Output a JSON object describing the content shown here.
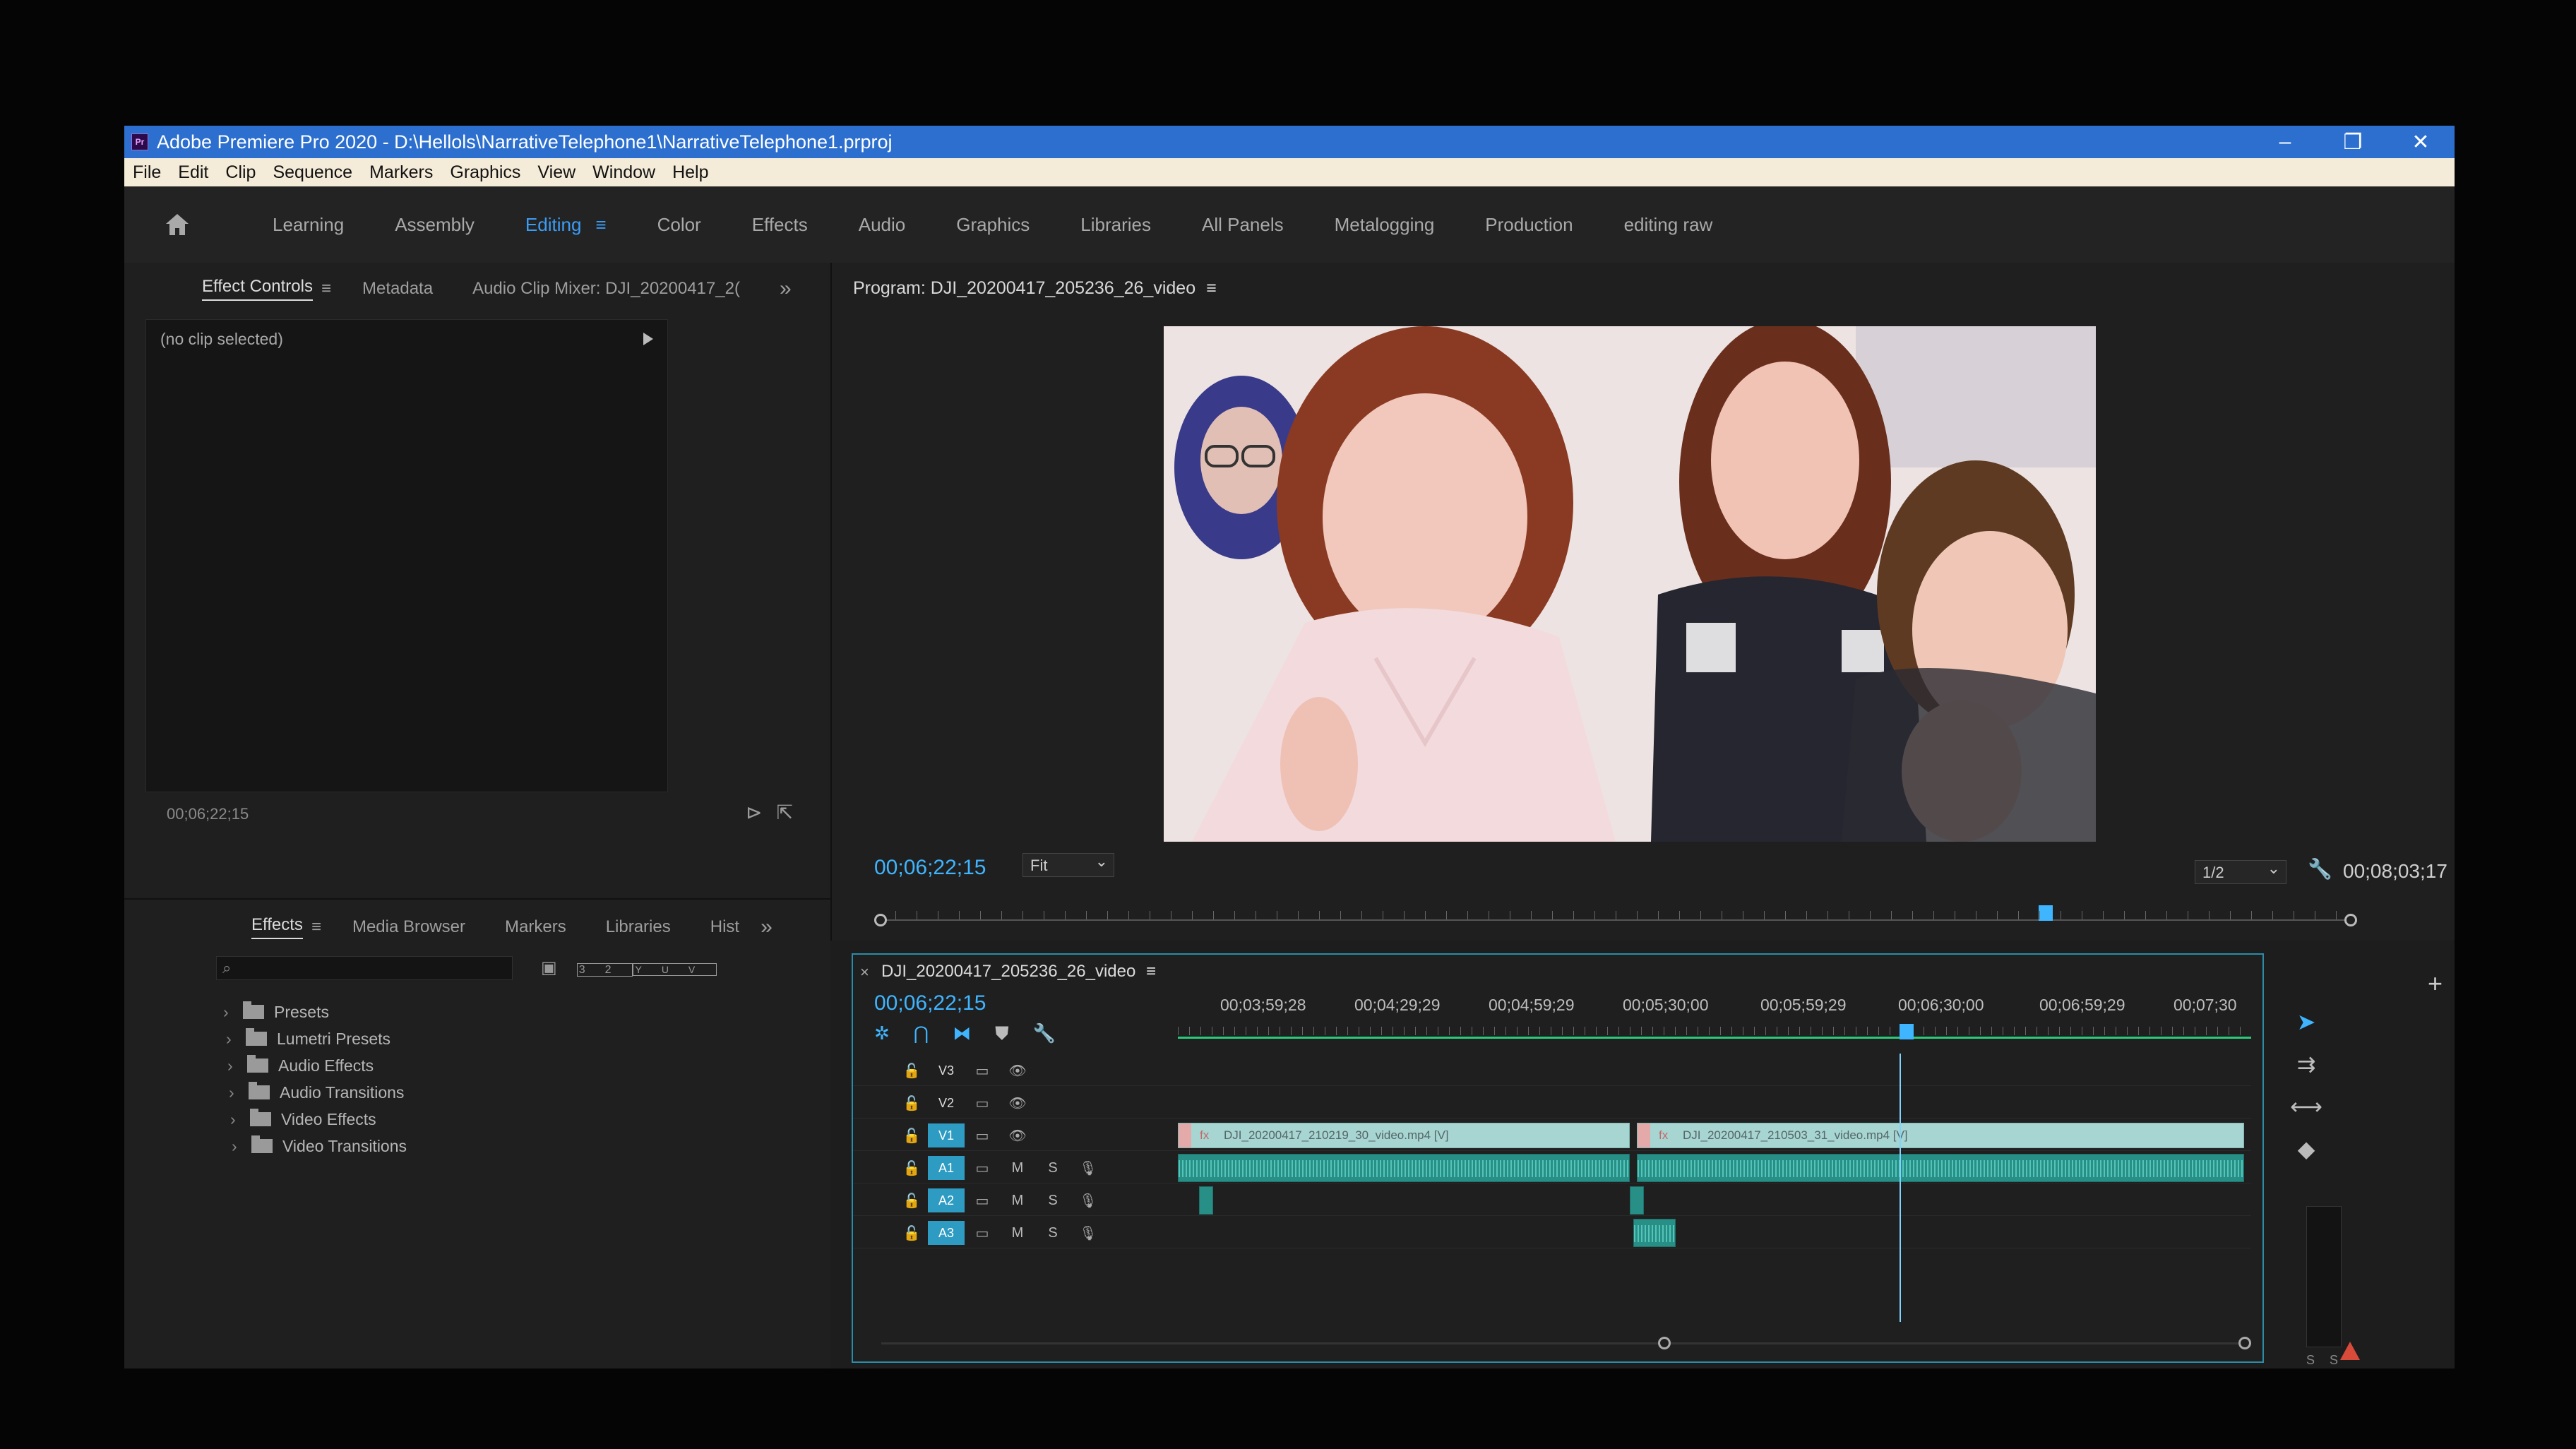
{
  "titlebar": {
    "title": "Adobe Premiere Pro 2020 - D:\\Hellols\\NarrativeTelephone1\\NarrativeTelephone1.prproj",
    "logo": "Pr",
    "minimize": "–",
    "restore": "❐",
    "close": "✕"
  },
  "menu": [
    "File",
    "Edit",
    "Clip",
    "Sequence",
    "Markers",
    "Graphics",
    "View",
    "Window",
    "Help"
  ],
  "workspaces": {
    "items": [
      "Learning",
      "Assembly",
      "Editing",
      "Color",
      "Effects",
      "Audio",
      "Graphics",
      "Libraries",
      "All Panels",
      "Metalogging",
      "Production",
      "editing raw"
    ],
    "active": "Editing",
    "menu_icon": "≡"
  },
  "effect_controls": {
    "tabs": [
      "Effect Controls",
      "Metadata",
      "Audio Clip Mixer: DJI_20200417_2("
    ],
    "tab_menu": "≡",
    "more": "»",
    "empty_text": "(no clip selected)",
    "timecode": "00;06;22;15"
  },
  "effects_panel": {
    "tabs": [
      "Effects",
      "Media Browser",
      "Markers",
      "Libraries",
      "Hist"
    ],
    "tab_menu": "≡",
    "more": "»",
    "tree": [
      "Presets",
      "Lumetri Presets",
      "Audio Effects",
      "Audio Transitions",
      "Video Effects",
      "Video Transitions"
    ],
    "tool_labels": [
      "32",
      "YUV"
    ]
  },
  "program_monitor": {
    "title": "Program: DJI_20200417_205236_26_video",
    "title_menu": "≡",
    "timecode": "00;06;22;15",
    "zoom": "Fit",
    "resolution": "1/2",
    "duration": "00;08;03;17",
    "playhead_fraction": 0.79,
    "plus": "+"
  },
  "timeline": {
    "close": "×",
    "sequence_name": "DJI_20200417_205236_26_video",
    "title_menu": "≡",
    "timecode": "00;06;22;15",
    "ruler_labels": [
      "00;03;59;28",
      "00;04;29;29",
      "00;04;59;29",
      "00;05;30;00",
      "00;05;59;29",
      "00;06;30;00",
      "00;06;59;29",
      "00;07;30"
    ],
    "video_tracks": [
      "V3",
      "V2",
      "V1"
    ],
    "audio_tracks": [
      "A1",
      "A2",
      "A3"
    ],
    "mute": "M",
    "solo": "S",
    "clips": {
      "v1_a": "DJI_20200417_210219_30_video.mp4 [V]",
      "v1_b": "DJI_20200417_210503_31_video.mp4 [V]"
    },
    "fx_badge": "fx"
  },
  "meter_label": "S S",
  "colors": {
    "accent": "#3fb5ff",
    "titlebar": "#2c6fce",
    "video_clip": "#a7d5d2",
    "audio_clip": "#278f86",
    "track_active": "#2e9bc2"
  }
}
